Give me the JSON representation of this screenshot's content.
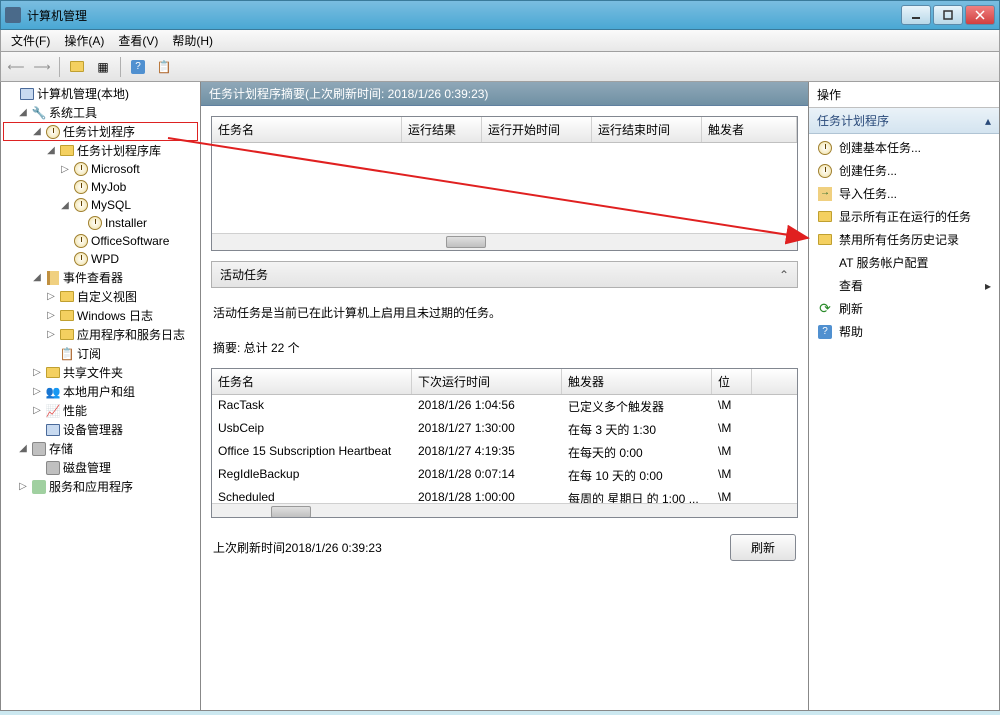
{
  "window": {
    "title": "计算机管理"
  },
  "menu": {
    "file": "文件(F)",
    "action": "操作(A)",
    "view": "查看(V)",
    "help": "帮助(H)"
  },
  "tree": {
    "root": "计算机管理(本地)",
    "systools": "系统工具",
    "scheduler": "任务计划程序",
    "schedlib": "任务计划程序库",
    "microsoft": "Microsoft",
    "myjob": "MyJob",
    "mysql": "MySQL",
    "installer": "Installer",
    "officesoftware": "OfficeSoftware",
    "wpd": "WPD",
    "eventviewer": "事件查看器",
    "customviews": "自定义视图",
    "winlogs": "Windows 日志",
    "appservicelogs": "应用程序和服务日志",
    "subscriptions": "订阅",
    "sharedfolders": "共享文件夹",
    "localusers": "本地用户和组",
    "performance": "性能",
    "devicemgr": "设备管理器",
    "storage": "存储",
    "diskmgmt": "磁盘管理",
    "services": "服务和应用程序"
  },
  "center": {
    "header": "任务计划程序摘要(上次刷新时间: 2018/1/26 0:39:23)",
    "cols": {
      "name": "任务名",
      "result": "运行结果",
      "start": "运行开始时间",
      "end": "运行结束时间",
      "trigger": "触发者"
    },
    "active_header": "活动任务",
    "active_desc": "活动任务是当前已在此计算机上启用且未过期的任务。",
    "summary": "摘要: 总计 22 个",
    "table_cols": {
      "name": "任务名",
      "next": "下次运行时间",
      "trigger": "触发器",
      "loc": "位"
    },
    "rows": [
      {
        "name": "RacTask",
        "next": "2018/1/26 1:04:56",
        "trigger": "已定义多个触发器",
        "loc": "\\M"
      },
      {
        "name": "UsbCeip",
        "next": "2018/1/27 1:30:00",
        "trigger": "在每 3 天的 1:30",
        "loc": "\\M"
      },
      {
        "name": "Office 15 Subscription Heartbeat",
        "next": "2018/1/27 4:19:35",
        "trigger": "在每天的 0:00",
        "loc": "\\M"
      },
      {
        "name": "RegIdleBackup",
        "next": "2018/1/28 0:07:14",
        "trigger": "在每 10 天的 0:00",
        "loc": "\\M"
      },
      {
        "name": "Scheduled",
        "next": "2018/1/28 1:00:00",
        "trigger": "每周的 星期日 的 1:00 ...",
        "loc": "\\M"
      }
    ],
    "footer_time": "上次刷新时间2018/1/26 0:39:23",
    "refresh_btn": "刷新"
  },
  "actions": {
    "title": "操作",
    "subtitle": "任务计划程序",
    "items": {
      "create_basic": "创建基本任务...",
      "create": "创建任务...",
      "import": "导入任务...",
      "show_running": "显示所有正在运行的任务",
      "disable_history": "禁用所有任务历史记录",
      "at_service": "AT 服务帐户配置",
      "view": "查看",
      "refresh": "刷新",
      "help": "帮助"
    }
  }
}
